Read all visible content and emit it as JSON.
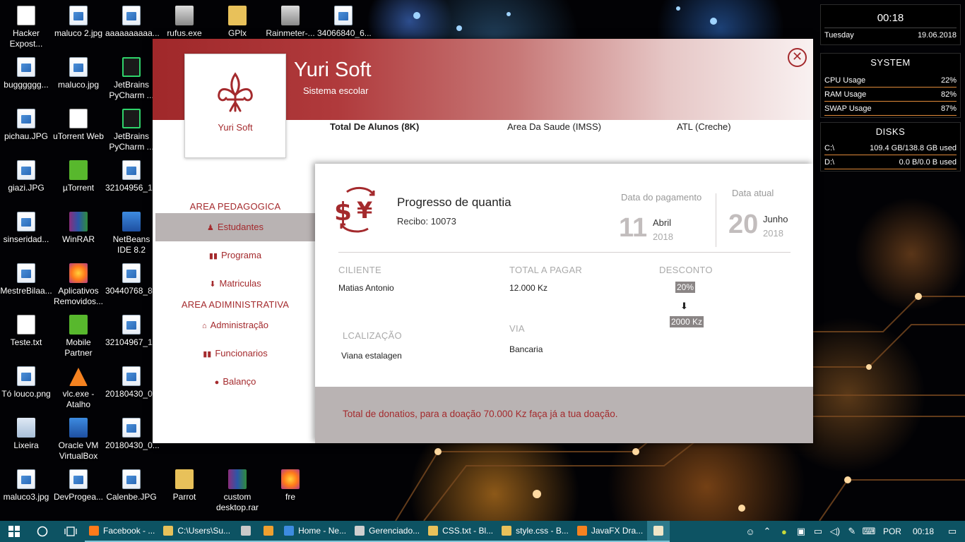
{
  "desktop": {
    "icons": [
      {
        "label": "Hacker Expost...",
        "kind": "doc"
      },
      {
        "label": "maluco 2.jpg",
        "kind": "img"
      },
      {
        "label": "aaaaaaaaaa...",
        "kind": "img"
      },
      {
        "label": "rufus.exe",
        "kind": "exe"
      },
      {
        "label": "GPlx",
        "kind": "folder"
      },
      {
        "label": "Rainmeter-...",
        "kind": "exe"
      },
      {
        "label": "34066840_6...",
        "kind": "img"
      },
      {
        "label": "bugggggg...",
        "kind": "img"
      },
      {
        "label": "maluco.jpg",
        "kind": "img"
      },
      {
        "label": "JetBrains PyCharm ...",
        "kind": "pc"
      },
      {
        "label": "pichau.JPG",
        "kind": "img"
      },
      {
        "label": "uTorrent Web",
        "kind": "doc"
      },
      {
        "label": "JetBrains PyCharm ...",
        "kind": "pc"
      },
      {
        "label": "giazi.JPG",
        "kind": "img"
      },
      {
        "label": "µTorrent",
        "kind": "green"
      },
      {
        "label": "32104956_1...",
        "kind": "img"
      },
      {
        "label": "sinseridad...",
        "kind": "img"
      },
      {
        "label": "WinRAR",
        "kind": "rar"
      },
      {
        "label": "NetBeans IDE 8.2",
        "kind": "box"
      },
      {
        "label": "MestreBilaa...",
        "kind": "img"
      },
      {
        "label": "Aplicativos Removidos...",
        "kind": "ff"
      },
      {
        "label": "30440768_8...",
        "kind": "img"
      },
      {
        "label": "Teste.txt",
        "kind": "doc"
      },
      {
        "label": "Mobile Partner",
        "kind": "green"
      },
      {
        "label": "32104967_1...",
        "kind": "img"
      },
      {
        "label": "Tó louco.png",
        "kind": "img"
      },
      {
        "label": "vlc.exe - Atalho",
        "kind": "vlc"
      },
      {
        "label": "20180430_0...",
        "kind": "img"
      },
      {
        "label": "Lixeira",
        "kind": "bin"
      },
      {
        "label": "Oracle VM VirtualBox",
        "kind": "box"
      },
      {
        "label": "20180430_0...",
        "kind": "img"
      },
      {
        "label": "maluco3.jpg",
        "kind": "img"
      },
      {
        "label": "DevProgea...",
        "kind": "img"
      },
      {
        "label": "Calenbe.JPG",
        "kind": "img"
      },
      {
        "label": "Parrot",
        "kind": "folder"
      },
      {
        "label": "custom desktop.rar",
        "kind": "rar"
      },
      {
        "label": "fre",
        "kind": "ff"
      }
    ]
  },
  "widgets": {
    "clock": {
      "time": "00:18",
      "day": "Tuesday",
      "date": "19.06.2018"
    },
    "system": {
      "title": "SYSTEM",
      "rows": [
        {
          "label": "CPU Usage",
          "value": "22%"
        },
        {
          "label": "RAM Usage",
          "value": "82%"
        },
        {
          "label": "SWAP Usage",
          "value": "87%"
        }
      ]
    },
    "disks": {
      "title": "DISKS",
      "rows": [
        {
          "label": "C:\\",
          "value": "109.4 GB/138.8 GB used"
        },
        {
          "label": "D:\\",
          "value": "0.0 B/0.0 B used"
        }
      ]
    }
  },
  "app": {
    "title": "Yuri Soft",
    "subtitle": "Sistema escolar",
    "logo_name": "Yuri Soft",
    "close_glyph": "✕",
    "stats": {
      "total": "Total De Alunos (8K)",
      "saude": "Area Da Saude (IMSS)",
      "atl": "ATL  (Creche)"
    },
    "sidebar": {
      "section_pedagogica": "AREA PEDAGOGICA",
      "section_administrativa": "AREA ADIMINISTRATIVA",
      "items": [
        {
          "label": "Estudantes",
          "icon": "user-icon",
          "glyph": "♟"
        },
        {
          "label": "Programa",
          "icon": "books-icon",
          "glyph": "▮▮"
        },
        {
          "label": "Matriculas",
          "icon": "download-arrow-icon",
          "glyph": "⬇"
        },
        {
          "label": "Administração",
          "icon": "bank-icon",
          "glyph": "⌂"
        },
        {
          "label": "Funcionarios",
          "icon": "books-icon",
          "glyph": "▮▮"
        },
        {
          "label": "Balanço",
          "icon": "money-bag-icon",
          "glyph": "●"
        }
      ]
    },
    "card": {
      "title": "Progresso de quantia",
      "receipt": "Recibo: 10073",
      "payment_date": {
        "label": "Data do pagamento",
        "day": "11",
        "month": "Abril",
        "year": "2018"
      },
      "current_date": {
        "label": "Data atual",
        "day": "20",
        "month": "Junho",
        "year": "2018"
      },
      "fields": {
        "cliente_label": "CILIENTE",
        "cliente_value": "Matias Antonio",
        "total_label": "TOTAL A PAGAR",
        "total_value": "12.000 Kz",
        "desconto_label": "DESCONTO",
        "desconto_percent": "20%",
        "desconto_arrow": "⬇",
        "desconto_amount": "2000 Kz",
        "localizacao_label": "LCALIZAÇÃO",
        "localizacao_value": "Viana estalagen",
        "via_label": "VIA",
        "via_value": "Bancaria"
      },
      "footer": "Total de donatios, para a doação 70.000 Kz faça já a tua doação."
    },
    "accent_color": "#a42a2d"
  },
  "taskbar": {
    "apps": [
      {
        "label": "Facebook - ...",
        "color": "#ff7a1a",
        "state": "open"
      },
      {
        "label": "C:\\Users\\Su...",
        "color": "#e8c15a",
        "state": "open"
      },
      {
        "label": "",
        "color": "#c9c9c9",
        "state": "open"
      },
      {
        "label": "",
        "color": "#f0a030",
        "state": "open"
      },
      {
        "label": "Home - Ne...",
        "color": "#3d8be0",
        "state": "open"
      },
      {
        "label": "Gerenciado...",
        "color": "#cfcfcf",
        "state": "open"
      },
      {
        "label": "CSS.txt - Bl...",
        "color": "#e8c15a",
        "state": "open"
      },
      {
        "label": "style.css - B...",
        "color": "#e8c15a",
        "state": "open"
      },
      {
        "label": "JavaFX Dra...",
        "color": "#f58220",
        "state": "open"
      },
      {
        "label": "",
        "color": "#f0e6c8",
        "state": "active"
      }
    ],
    "language": "POR",
    "time": "00:18"
  }
}
